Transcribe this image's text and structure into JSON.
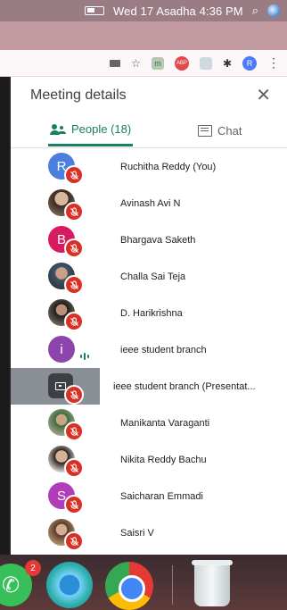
{
  "menubar": {
    "clock": "Wed 17 Asadha  4:36 PM",
    "search_icon": "search-icon",
    "siri_icon": "siri-icon",
    "list_icon": "notification-center-icon"
  },
  "panel": {
    "title": "Meeting details",
    "close_glyph": "✕"
  },
  "tabs": {
    "people_label": "People (18)",
    "chat_label": "Chat"
  },
  "participants": [
    {
      "name": "Ruchitha Reddy (You)",
      "avatar_letter": "R",
      "avatar_color": "#4a7fe0",
      "state": "muted"
    },
    {
      "name": "Avinash Avi N",
      "avatar_letter": "",
      "avatar_color": "",
      "state": "muted"
    },
    {
      "name": "Bhargava Saketh",
      "avatar_letter": "B",
      "avatar_color": "#d81b60",
      "state": "muted"
    },
    {
      "name": "Challa Sai Teja",
      "avatar_letter": "",
      "avatar_color": "",
      "state": "muted"
    },
    {
      "name": "D. Harikrishna",
      "avatar_letter": "",
      "avatar_color": "",
      "state": "muted"
    },
    {
      "name": "ieee student branch",
      "avatar_letter": "i",
      "avatar_color": "#8e44ad",
      "state": "speaking"
    },
    {
      "name": "ieee student branch (Presentat...",
      "avatar_letter": "",
      "avatar_color": "",
      "state": "presenting"
    },
    {
      "name": "Manikanta Varaganti",
      "avatar_letter": "",
      "avatar_color": "",
      "state": "muted"
    },
    {
      "name": "Nikita Reddy Bachu",
      "avatar_letter": "",
      "avatar_color": "",
      "state": "muted"
    },
    {
      "name": "Saicharan Emmadi",
      "avatar_letter": "S",
      "avatar_color": "#b03cb9",
      "state": "muted"
    },
    {
      "name": "Saisri V",
      "avatar_letter": "",
      "avatar_color": "",
      "state": "muted"
    }
  ],
  "toolbar": {
    "profile_letter": "R"
  },
  "dock": {
    "phone_badge": "2"
  },
  "colors": {
    "accent": "#1a7f64",
    "mute_red": "#d93025"
  }
}
